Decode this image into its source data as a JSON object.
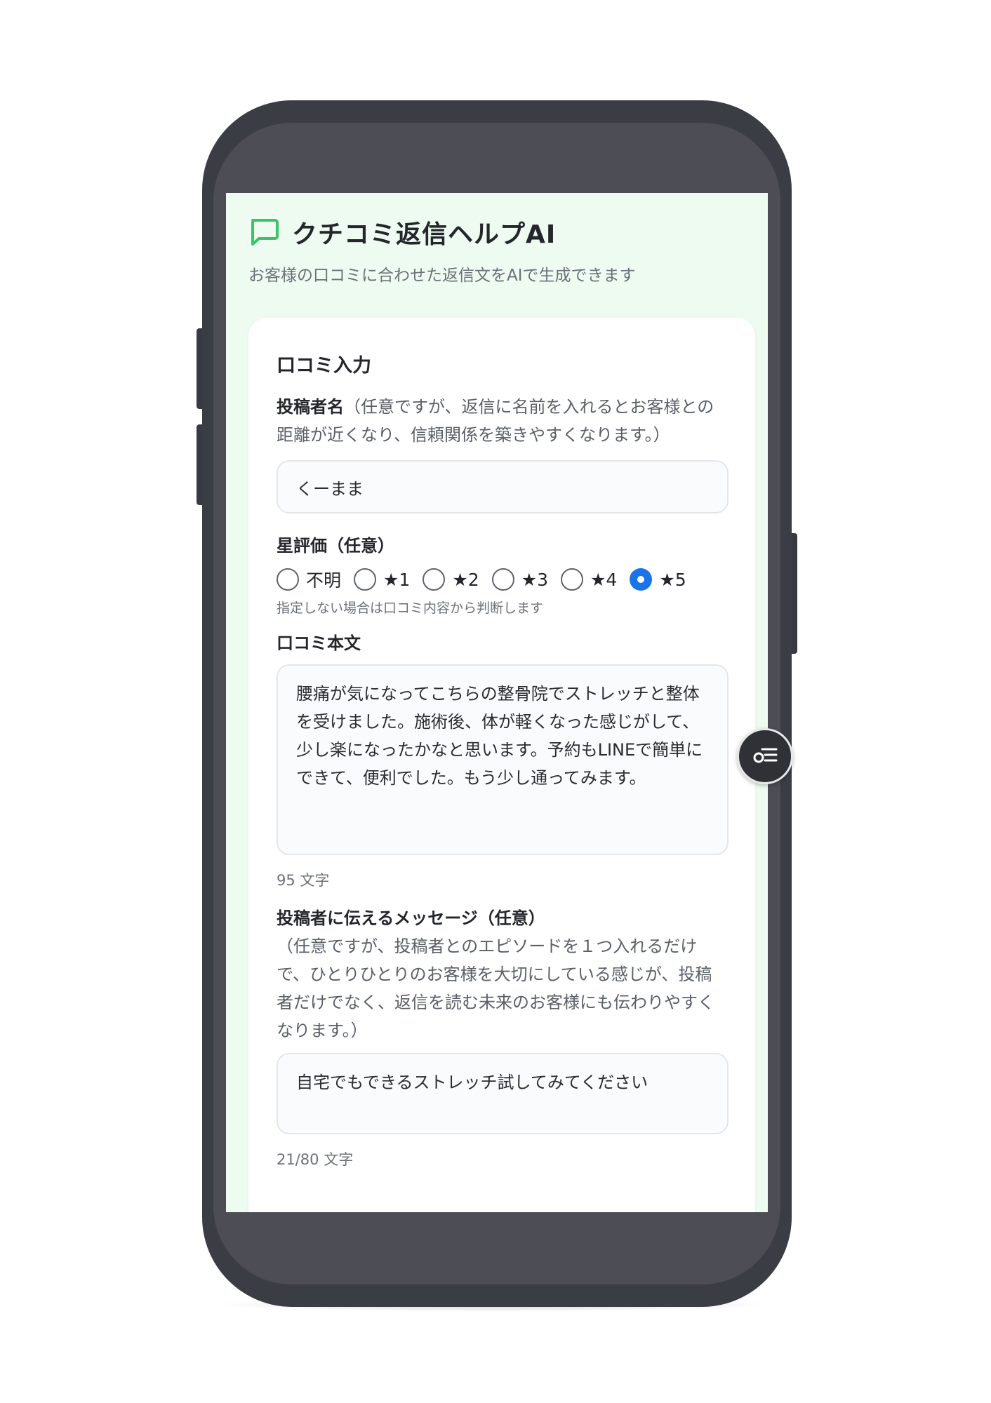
{
  "app": {
    "title": "クチコミ返信ヘルプAI",
    "subtitle": "お客様の口コミに合わせた返信文をAIで生成できます"
  },
  "form": {
    "section_title": "口コミ入力",
    "poster_name": {
      "label": "投稿者名",
      "note": "（任意ですが、返信に名前を入れるとお客様との距離が近くなり、信頼関係を築きやすくなります。）",
      "value": "くーまま"
    },
    "rating": {
      "label": "星評価（任意）",
      "options": [
        "不明",
        "★1",
        "★2",
        "★3",
        "★4",
        "★5"
      ],
      "selected": "★5",
      "hint": "指定しない場合は口コミ内容から判断します"
    },
    "review_body": {
      "label": "口コミ本文",
      "value": "腰痛が気になってこちらの整骨院でストレッチと整体を受けました。施術後、体が軽くなった感じがして、少し楽になったかなと思います。予約もLINEで簡単にできて、便利でした。もう少し通ってみます。",
      "counter": "95 文字"
    },
    "message": {
      "label": "投稿者に伝えるメッセージ（任意）",
      "note": "（任意ですが、投稿者とのエピソードを１つ入れるだけで、ひとりひとりのお客様を大切にしている感じが、投稿者だけでなく、返信を読む未来のお客様にも伝わりやすくなります。）",
      "value": "自宅でもできるストレッチ試してみてください",
      "counter": "21/80 文字"
    }
  },
  "colors": {
    "accent_green": "#3cc26a",
    "radio_selected": "#1a73e8",
    "screen_bg": "#eefbf0",
    "phone_body": "#3b3d44"
  },
  "icons": {
    "title_icon": "chat-bubble-icon",
    "floating_button_icon": "menu-toggle-icon"
  }
}
